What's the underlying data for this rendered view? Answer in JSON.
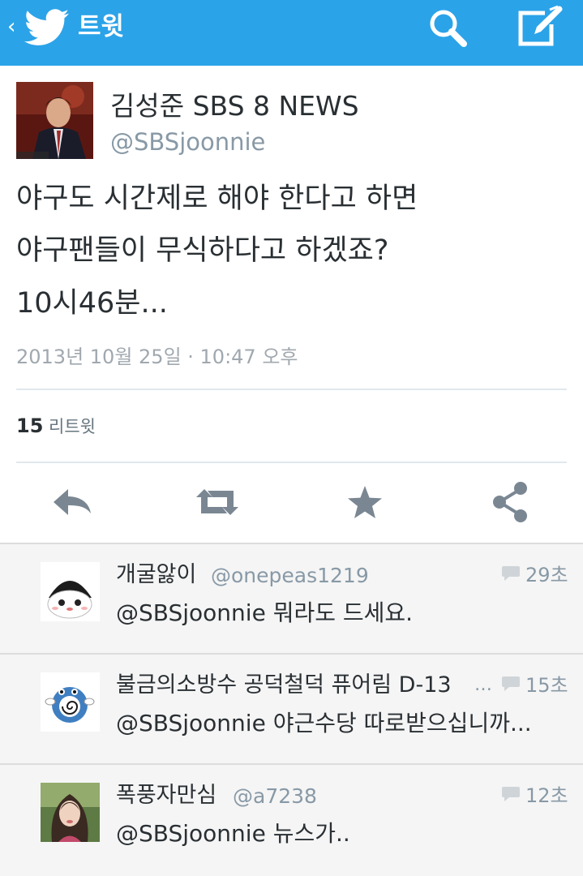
{
  "topbar": {
    "back_glyph": "‹",
    "title": "트윗",
    "bird_icon": "twitter-bird-icon",
    "search_icon": "search-icon",
    "compose_icon": "compose-icon",
    "bg_color": "#2ba3e8"
  },
  "tweet": {
    "display_name": "김성준 SBS 8 NEWS",
    "handle": "@SBSjoonnie",
    "text_lines": [
      "야구도 시간제로 해야 한다고 하면",
      "야구팬들이 무식하다고 하겠죠?",
      "10시46분..."
    ],
    "timestamp": "2013년 10월 25일 · 10:47 오후",
    "retweet_count": "15",
    "retweet_label": "리트윗",
    "actions": [
      "reply-icon",
      "retweet-icon",
      "star-icon",
      "share-icon"
    ]
  },
  "replies": [
    {
      "name": "개굴앓이",
      "handle": "@onepeas1219",
      "age": "29초",
      "text": "@SBSjoonnie 뭐라도 드세요."
    },
    {
      "name": "불금의소방수 공덕철덕 퓨어림 D-13",
      "handle": "…",
      "age": "15초",
      "text": "@SBSjoonnie 야근수당 따로받으십니까..."
    },
    {
      "name": "폭풍자만심",
      "handle": "@a7238",
      "age": "12초",
      "text": "@SBSjoonnie 뉴스가.."
    }
  ]
}
